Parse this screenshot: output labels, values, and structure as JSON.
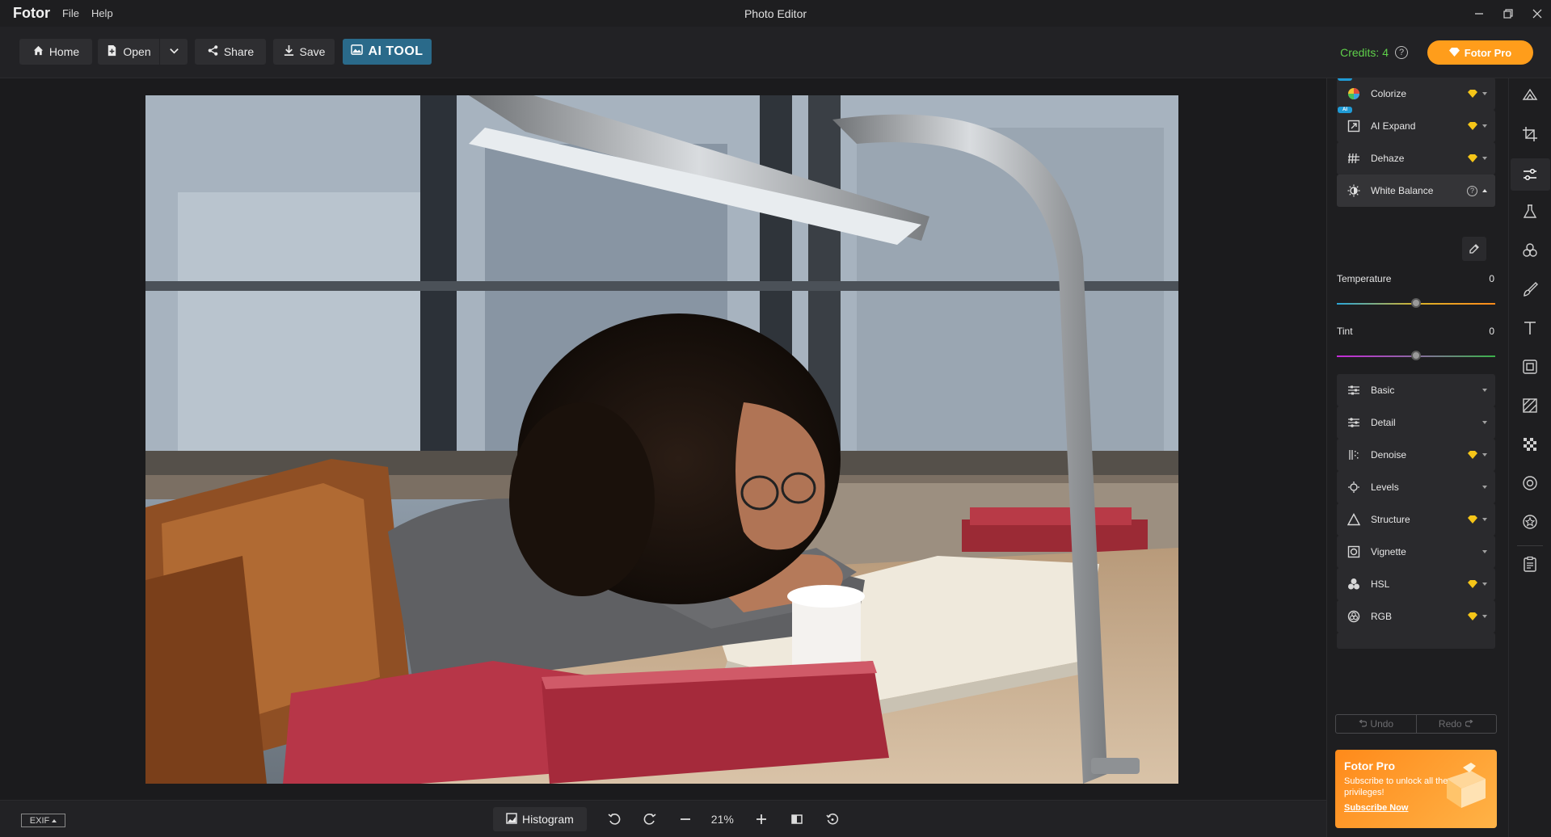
{
  "app": {
    "brand": "Fotor",
    "menu": [
      "File",
      "Help"
    ],
    "window_title": "Photo Editor"
  },
  "toolbar": {
    "home": "Home",
    "open": "Open",
    "share": "Share",
    "save": "Save",
    "ai_tool": "AI TOOL",
    "credits": "Credits: 4",
    "pro_button": "Fotor Pro"
  },
  "panel": {
    "items_top": [
      {
        "label": "Colorize",
        "premium": true,
        "ai": true,
        "icon": "colorize-icon"
      },
      {
        "label": "AI Expand",
        "premium": true,
        "ai": true,
        "icon": "ai-expand-icon"
      },
      {
        "label": "Dehaze",
        "premium": true,
        "ai": false,
        "icon": "dehaze-icon"
      }
    ],
    "white_balance": {
      "label": "White Balance",
      "temperature_label": "Temperature",
      "temperature_value": "0",
      "temperature_level": 0.5,
      "tint_label": "Tint",
      "tint_value": "0",
      "tint_level": 0.5
    },
    "items_bottom": [
      {
        "label": "Basic",
        "premium": false,
        "icon": "basic-icon"
      },
      {
        "label": "Detail",
        "premium": false,
        "icon": "detail-icon"
      },
      {
        "label": "Denoise",
        "premium": true,
        "icon": "denoise-icon"
      },
      {
        "label": "Levels",
        "premium": false,
        "icon": "levels-icon"
      },
      {
        "label": "Structure",
        "premium": true,
        "icon": "structure-icon"
      },
      {
        "label": "Vignette",
        "premium": false,
        "icon": "vignette-icon"
      },
      {
        "label": "HSL",
        "premium": true,
        "icon": "hsl-icon"
      },
      {
        "label": "RGB",
        "premium": true,
        "icon": "rgb-icon"
      }
    ],
    "undo": "Undo",
    "redo": "Redo",
    "promo": {
      "title": "Fotor Pro",
      "subtitle": "Subscribe to unlock all the privileges!",
      "link": "Subscribe Now"
    }
  },
  "bottom": {
    "exif": "EXIF",
    "histogram": "Histogram",
    "zoom": "21%"
  },
  "colors": {
    "accent_green": "#5fd04a",
    "pro_orange": "#ff9d1b",
    "premium_gold": "#f5c518",
    "ai_tool_bg": "#2a6a8a"
  }
}
